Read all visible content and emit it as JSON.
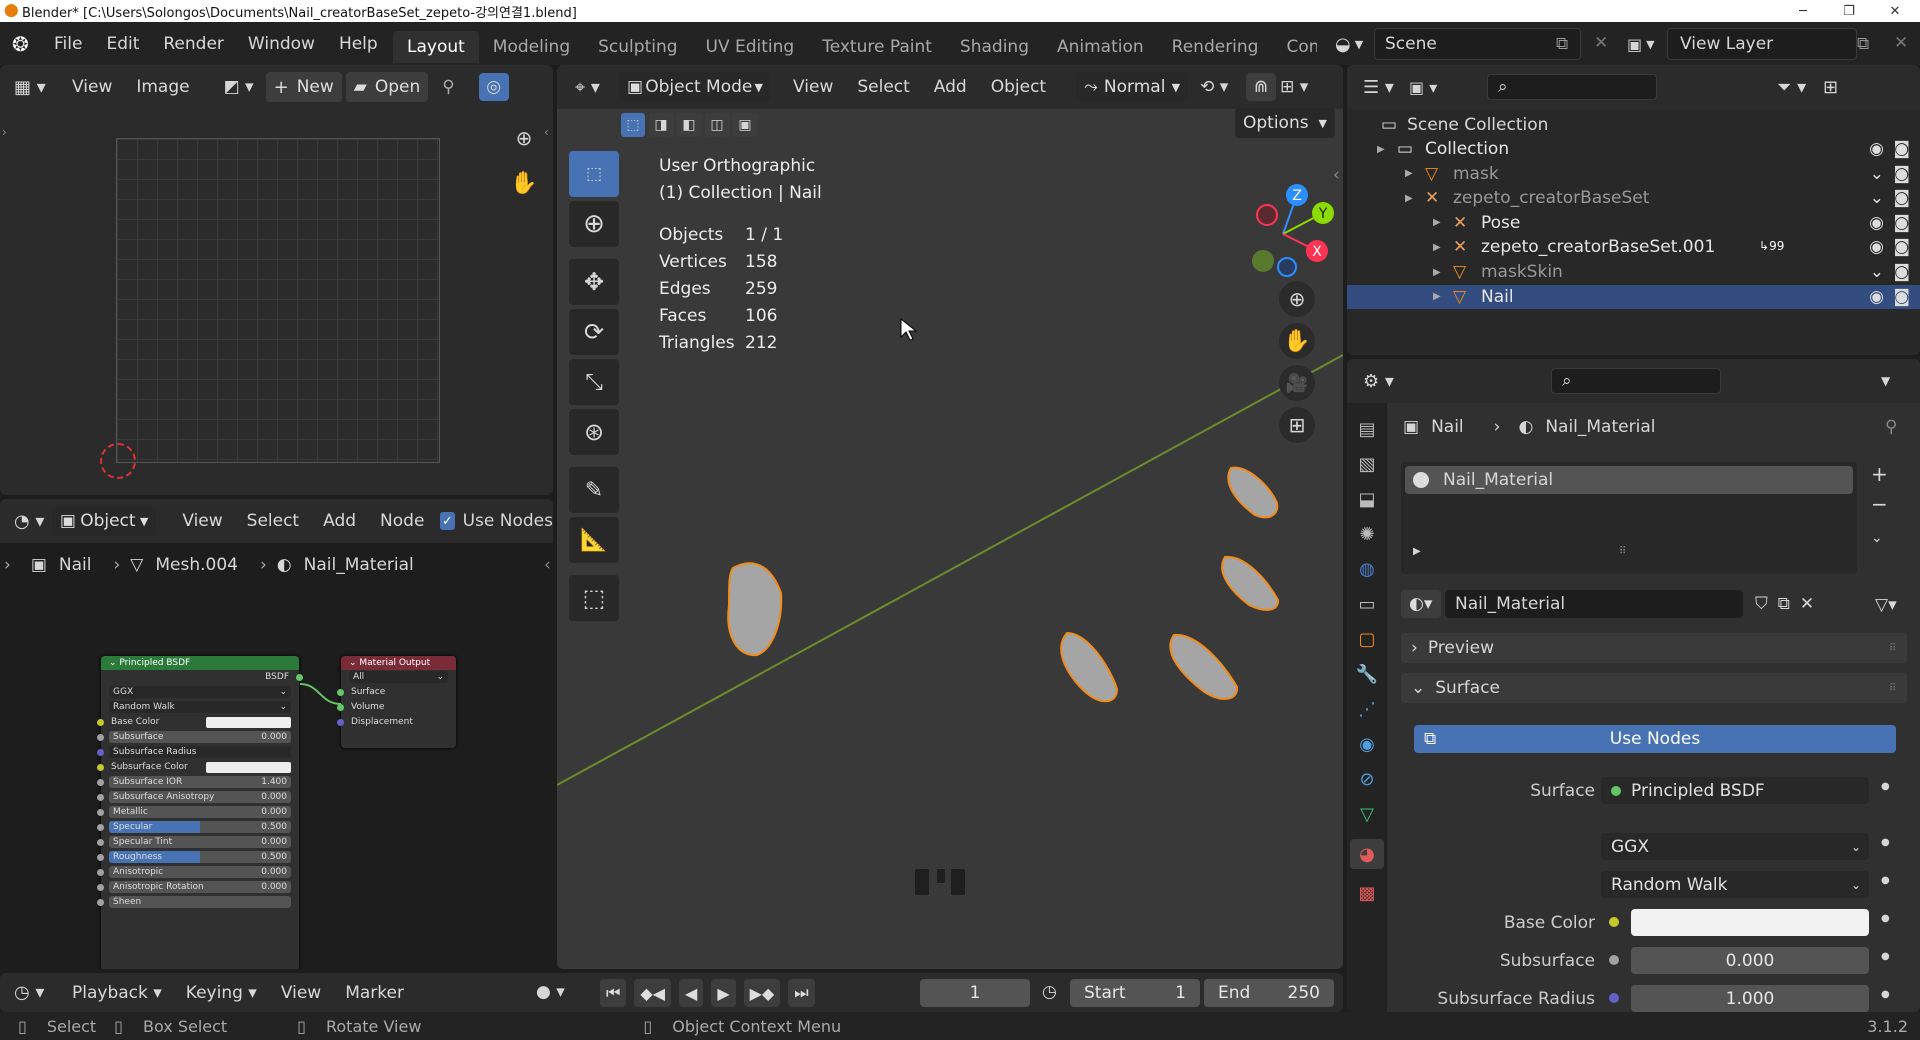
{
  "window": {
    "title": "Blender* [C:\\Users\\Solongos\\Documents\\Nail_creatorBaseSet_zepeto-강의연결1.blend]",
    "minimize": "─",
    "maximize": "❐",
    "close": "✕"
  },
  "menu": [
    "File",
    "Edit",
    "Render",
    "Window",
    "Help"
  ],
  "workspaces": [
    "Layout",
    "Modeling",
    "Sculpting",
    "UV Editing",
    "Texture Paint",
    "Shading",
    "Animation",
    "Rendering",
    "Compo"
  ],
  "scene": {
    "name": "Scene",
    "view_layer": "View Layer"
  },
  "image_editor": {
    "view": "View",
    "image": "Image",
    "new": "New",
    "open": "Open"
  },
  "node_editor": {
    "type": "Object",
    "view": "View",
    "select": "Select",
    "add": "Add",
    "node": "Node",
    "use_nodes": "Use Nodes",
    "breadcrumb": [
      "Nail",
      "Mesh.004",
      "Nail_Material"
    ]
  },
  "bsdf_node": {
    "title": "Principled BSDF",
    "output": "BSDF",
    "dist": "GGX",
    "sss": "Random Walk",
    "rows": [
      {
        "label": "Base Color",
        "value": "",
        "color": true
      },
      {
        "label": "Subsurface",
        "value": "0.000"
      },
      {
        "label": "Subsurface Radius",
        "value": "",
        "drop": true
      },
      {
        "label": "Subsurface Color",
        "value": "",
        "color": true
      },
      {
        "label": "Subsurface IOR",
        "value": "1.400"
      },
      {
        "label": "Subsurface Anisotropy",
        "value": "0.000"
      },
      {
        "label": "Metallic",
        "value": "0.000"
      },
      {
        "label": "Specular",
        "value": "0.500",
        "fill": 0.5
      },
      {
        "label": "Specular Tint",
        "value": "0.000"
      },
      {
        "label": "Roughness",
        "value": "0.500",
        "fill": 0.5
      },
      {
        "label": "Anisotropic",
        "value": "0.000"
      },
      {
        "label": "Anisotropic Rotation",
        "value": "0.000"
      },
      {
        "label": "Sheen",
        "value": ""
      }
    ]
  },
  "output_node": {
    "title": "Material Output",
    "target": "All",
    "inputs": [
      "Surface",
      "Volume",
      "Displacement"
    ]
  },
  "viewport": {
    "mode": "Object Mode",
    "menus": [
      "View",
      "Select",
      "Add",
      "Object"
    ],
    "orientation": "Normal",
    "options": "Options",
    "view_name": "User Orthographic",
    "collection_info": "(1) Collection | Nail",
    "stats": [
      {
        "k": "Objects",
        "v": "1 / 1"
      },
      {
        "k": "Vertices",
        "v": "158"
      },
      {
        "k": "Edges",
        "v": "259"
      },
      {
        "k": "Faces",
        "v": "106"
      },
      {
        "k": "Triangles",
        "v": "212"
      }
    ],
    "gizmo": {
      "z": "Z",
      "y": "Y",
      "x": "X"
    }
  },
  "outliner": {
    "scene_collection": "Scene Collection",
    "items": [
      {
        "name": "Collection",
        "depth": 0
      },
      {
        "name": "mask",
        "depth": 1
      },
      {
        "name": "zepeto_creatorBaseSet",
        "depth": 1
      },
      {
        "name": "Pose",
        "depth": 2
      },
      {
        "name": "zepeto_creatorBaseSet.001",
        "depth": 2,
        "badge": "99"
      },
      {
        "name": "maskSkin",
        "depth": 2
      },
      {
        "name": "Nail",
        "depth": 2,
        "selected": true
      }
    ]
  },
  "properties": {
    "breadcrumb_obj": "Nail",
    "breadcrumb_mat": "Nail_Material",
    "slot": "Nail_Material",
    "material": "Nail_Material",
    "preview": "Preview",
    "surface_panel": "Surface",
    "use_nodes": "Use Nodes",
    "rows": [
      {
        "label": "Surface",
        "value": "Principled BSDF"
      },
      {
        "label": "",
        "value": "GGX"
      },
      {
        "label": "",
        "value": "Random Walk"
      },
      {
        "label": "Base Color",
        "value": ""
      },
      {
        "label": "Subsurface",
        "value": "0.000"
      },
      {
        "label": "Subsurface Radius",
        "value": "1.000"
      }
    ]
  },
  "timeline": {
    "playback": "Playback",
    "keying": "Keying",
    "view": "View",
    "marker": "Marker",
    "frame": "1",
    "start_label": "Start",
    "start": "1",
    "end_label": "End",
    "end": "250"
  },
  "status": {
    "select": "Select",
    "box_select": "Box Select",
    "rotate_view": "Rotate View",
    "context_menu": "Object Context Menu",
    "version": "3.1.2"
  }
}
